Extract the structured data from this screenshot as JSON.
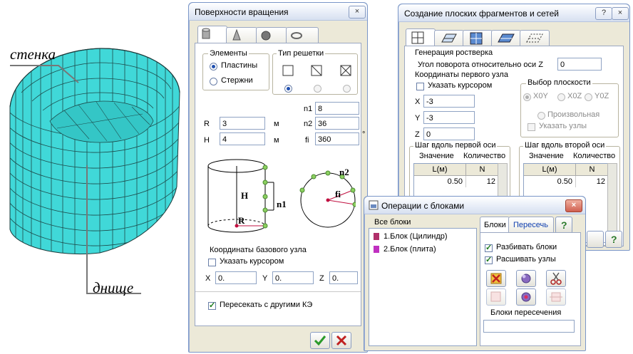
{
  "illustration": {
    "wall_label": "стенка",
    "bottom_label": "днище"
  },
  "rotation_dialog": {
    "title": "Поверхности вращения",
    "elements_group": "Элементы",
    "elements_options": [
      "Пластины",
      "Стержни"
    ],
    "grid_type_group": "Тип решетки",
    "fields": {
      "n1_label": "n1",
      "n1_value": "8",
      "R_label": "R",
      "R_value": "3",
      "R_unit": "м",
      "n2_label": "n2",
      "n2_value": "36",
      "H_label": "H",
      "H_value": "4",
      "H_unit": "м",
      "fi_label": "fi",
      "fi_value": "360",
      "fi_unit": "°"
    },
    "figure_labels": {
      "H": "H",
      "R": "R",
      "n1": "n1",
      "n2": "n2",
      "fi": "fi"
    },
    "base_node_group": "Координаты базового узла",
    "cursor_checkbox": "Указать курсором",
    "coords": {
      "x_label": "X",
      "x_value": "0.",
      "y_label": "Y",
      "y_value": "0.",
      "z_label": "Z",
      "z_value": "0."
    },
    "intersect_checkbox": "Пересекать с другими КЭ"
  },
  "flat_dialog": {
    "title": "Создание плоских фрагментов и сетей",
    "group_title": "Генерация ростверка",
    "angle_label": "Угол поворота относительно оси Z",
    "angle_value": "0",
    "first_node_label": "Координаты первого узла",
    "cursor_checkbox": "Указать курсором",
    "x_label": "X",
    "x_value": "-3",
    "y_label": "Y",
    "y_value": "-3",
    "z_label": "Z",
    "z_value": "0",
    "plane_group": "Выбор плоскости",
    "plane_options": [
      "X0Y",
      "X0Z",
      "Y0Z"
    ],
    "arbitrary_label": "Произвольная",
    "nodes_checkbox": "Указать узлы",
    "step1_title": "Шаг вдоль первой оси",
    "step2_title": "Шаг вдоль второй оси",
    "value_col": "Значение",
    "count_col": "Количество",
    "L_header": "L(м)",
    "N_header": "N",
    "step1_L": "0.50",
    "step1_N": "12",
    "step2_L": "0.50",
    "step2_N": "12"
  },
  "blocks_dialog": {
    "title": "Операции с блоками",
    "all_blocks": "Все блоки",
    "blocks": [
      {
        "label": "1.Блок (Цилиндр)",
        "color": "#b0306a"
      },
      {
        "label": "2.Блок (плита)",
        "color": "#c030c0"
      }
    ],
    "tab_blocks": "Блоки",
    "tab_intersect": "Пересечь",
    "split_checkbox": "Разбивать блоки",
    "unstitch_checkbox": "Расшивать узлы",
    "intersection_blocks": "Блоки пересечения"
  },
  "colors": {
    "mesh": "#40d8d8",
    "title_gradient_top": "#ffffff",
    "panel": "#ece9d8"
  }
}
